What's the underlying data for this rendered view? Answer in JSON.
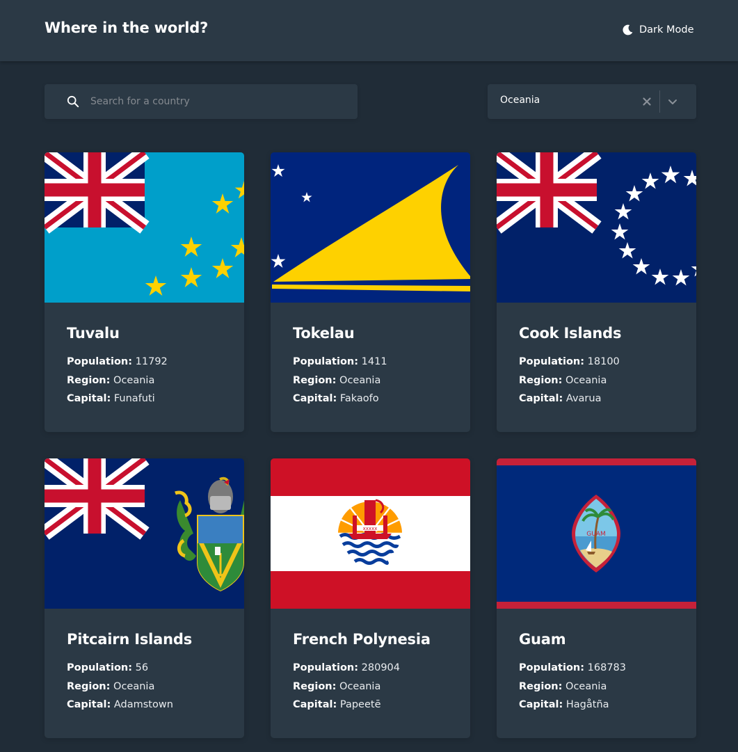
{
  "header": {
    "title": "Where in the world?",
    "theme_toggle_label": "Dark Mode",
    "theme_icon": "moon-icon"
  },
  "search": {
    "placeholder": "Search for a country",
    "value": "",
    "icon": "search-icon"
  },
  "region_filter": {
    "selected": "Oceania",
    "clear_icon": "clear-icon",
    "dropdown_icon": "chevron-down-icon"
  },
  "labels": {
    "population": "Population:",
    "region": "Region:",
    "capital": "Capital:"
  },
  "countries": [
    {
      "name": "Tuvalu",
      "population": "11792",
      "region": "Oceania",
      "capital": "Funafuti",
      "flag": "tuvalu-flag"
    },
    {
      "name": "Tokelau",
      "population": "1411",
      "region": "Oceania",
      "capital": "Fakaofo",
      "flag": "tokelau-flag"
    },
    {
      "name": "Cook Islands",
      "population": "18100",
      "region": "Oceania",
      "capital": "Avarua",
      "flag": "cook-islands-flag"
    },
    {
      "name": "Pitcairn Islands",
      "population": "56",
      "region": "Oceania",
      "capital": "Adamstown",
      "flag": "pitcairn-islands-flag"
    },
    {
      "name": "French Polynesia",
      "population": "280904",
      "region": "Oceania",
      "capital": "Papeetē",
      "flag": "french-polynesia-flag"
    },
    {
      "name": "Guam",
      "population": "168783",
      "region": "Oceania",
      "capital": "Hagåtña",
      "flag": "guam-flag"
    }
  ],
  "colors": {
    "background": "#202c37",
    "surface": "#2b3945",
    "text": "#ffffff"
  }
}
